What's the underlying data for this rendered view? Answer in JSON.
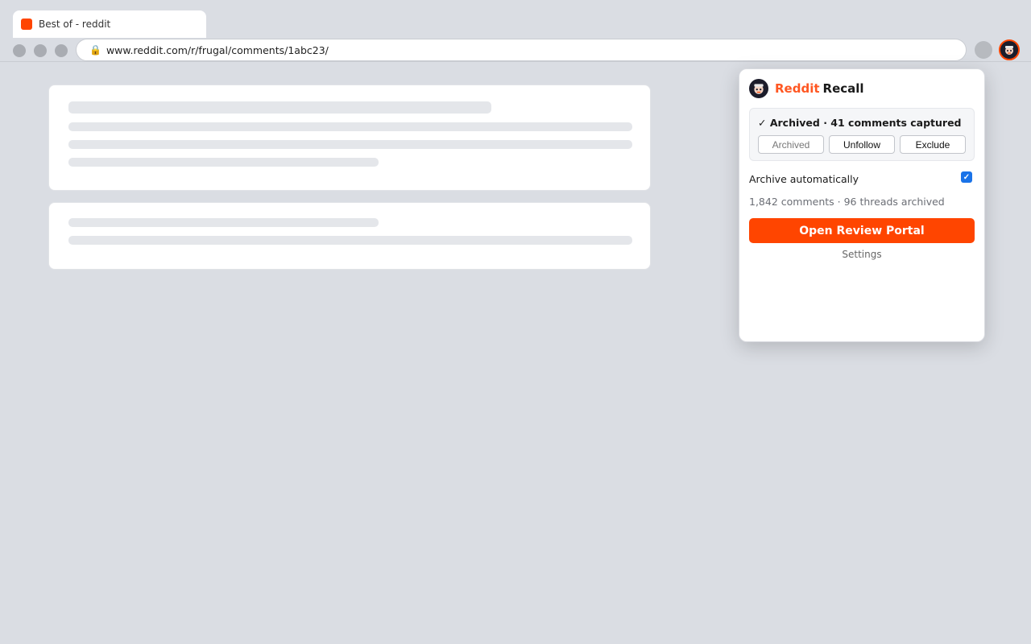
{
  "browser": {
    "tab_title": "Best of - reddit",
    "url": "www.reddit.com/r/frugal/comments/1abc23/",
    "accent_color": "#ff4500"
  },
  "popup": {
    "brand_first": "Reddit",
    "brand_second": "Recall",
    "status_check": "✓",
    "status_bold": "Archived",
    "status_rest": " · 41 comments captured",
    "buttons": {
      "archived": "Archived",
      "unfollow": "Unfollow",
      "exclude": "Exclude"
    },
    "auto_label": "Archive automatically",
    "auto_checked": true,
    "stats": "1,842 comments · 96 threads archived",
    "portal_label": "Open Review Portal",
    "settings_label": "Settings"
  }
}
